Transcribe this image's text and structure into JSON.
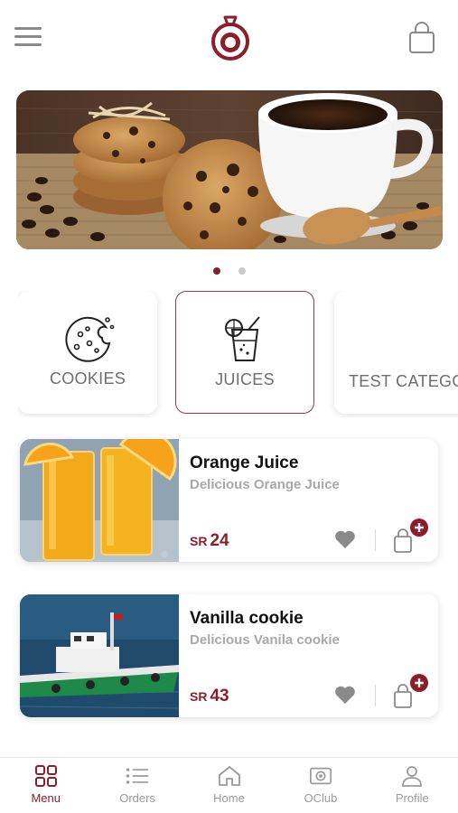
{
  "header": {
    "menu_icon": "hamburger-menu-icon",
    "logo_icon": "brand-logo-icon",
    "cart_icon": "shopping-bag-icon"
  },
  "banner": {
    "image": "cookies-and-coffee-cup-photo",
    "slides_total": 2,
    "active_slide": 1
  },
  "categories": [
    {
      "label": "COOKIES",
      "icon": "cookie-icon",
      "selected": false
    },
    {
      "label": "JUICES",
      "icon": "juice-glass-icon",
      "selected": true
    },
    {
      "label": "TEST CATEGO...",
      "icon": "",
      "selected": false
    }
  ],
  "products": [
    {
      "name": "Orange Juice",
      "description": "Delicious Orange Juice",
      "currency": "SR",
      "price": "24",
      "image": "orange-juice-glasses-photo"
    },
    {
      "name": "Vanilla cookie",
      "description": "Delicious Vanila cookie",
      "currency": "SR",
      "price": "43",
      "image": "tugboat-photo"
    }
  ],
  "nav": [
    {
      "label": "Menu",
      "icon": "grid-icon",
      "active": true
    },
    {
      "label": "Orders",
      "icon": "list-icon",
      "active": false
    },
    {
      "label": "Home",
      "icon": "home-icon",
      "active": false
    },
    {
      "label": "OClub",
      "icon": "club-icon",
      "active": false
    },
    {
      "label": "Profile",
      "icon": "profile-icon",
      "active": false
    }
  ],
  "colors": {
    "brand": "#8b1e2a",
    "text_muted": "#a8a8a8",
    "icon_gray": "#8a8a8a"
  }
}
